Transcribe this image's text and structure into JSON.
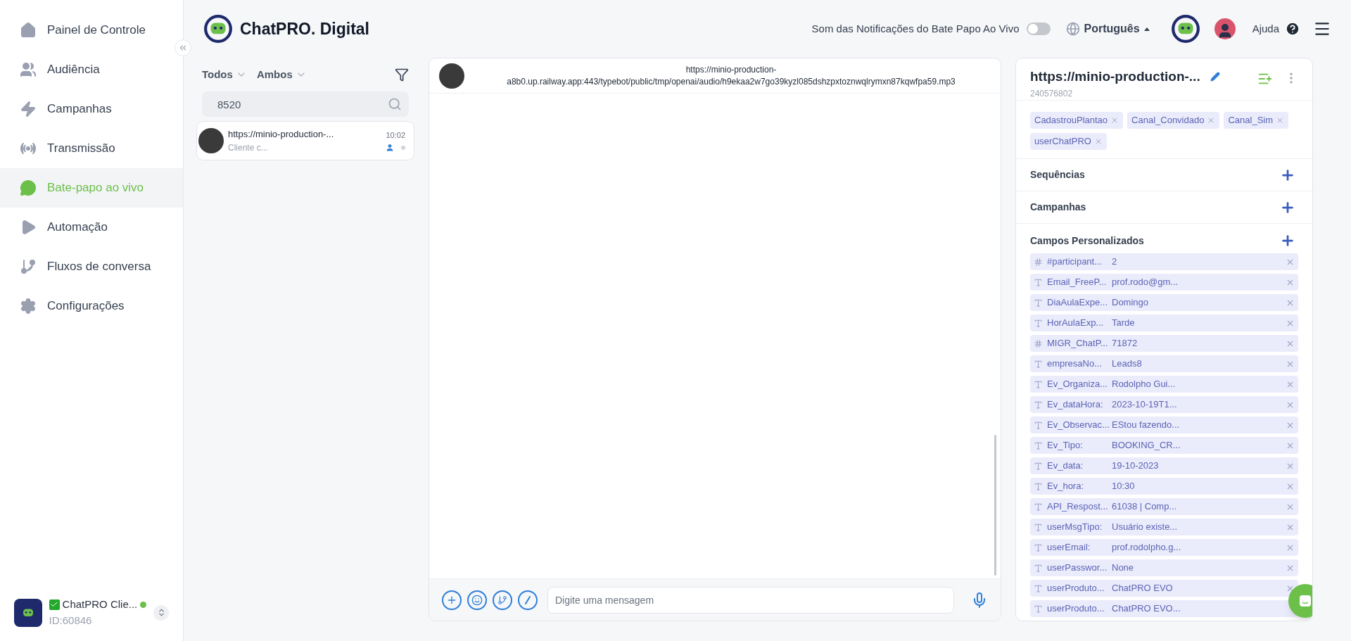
{
  "sidebar": {
    "items": [
      {
        "label": "Painel de Controle",
        "selected": false
      },
      {
        "label": "Audiência",
        "selected": false
      },
      {
        "label": "Campanhas",
        "selected": false
      },
      {
        "label": "Transmissão",
        "selected": false
      },
      {
        "label": "Bate-papo ao vivo",
        "selected": true
      },
      {
        "label": "Automação",
        "selected": false
      },
      {
        "label": "Fluxos de conversa",
        "selected": false
      },
      {
        "label": "Configurações",
        "selected": false
      }
    ],
    "account": {
      "name": "ChatPRO Clie...",
      "id": "ID:60846",
      "online": true
    }
  },
  "header": {
    "brand": "ChatPRO. Digital",
    "notification_label": "Som das Notificações do Bate Papo Ao Vivo",
    "notification_on": false,
    "language": "Português",
    "help": "Ajuda"
  },
  "chat_list": {
    "filters": [
      "Todos",
      "Ambos"
    ],
    "search": {
      "value": "8520"
    },
    "items": [
      {
        "title": "https://minio-production-...",
        "preview": "Cliente c...",
        "time": "10:02",
        "selected": true
      }
    ]
  },
  "conversation": {
    "title": "https://minio-production-a8b0.up.railway.app:443/typebot/public/tmp/openai/audio/h9ekaa2w7go39kyzl085dshzpxtoznwqlrymxn87kqwfpa59.mp3",
    "input": {
      "placeholder": "Digite uma mensagem"
    }
  },
  "contact": {
    "name": "https://minio-production-...",
    "id": "240576802",
    "tags": [
      "CadastrouPlantao",
      "Canal_Convidado",
      "Canal_Sim",
      "userChatPRO"
    ],
    "sections": [
      "Sequências",
      "Campanhas",
      "Campos Personalizados"
    ],
    "fields": [
      {
        "kind": "number",
        "name": "#participant...",
        "value": "2",
        "remove_visible": true
      },
      {
        "kind": "text",
        "name": "Email_FreeP...",
        "value": "prof.rodo@gm...",
        "remove_visible": true
      },
      {
        "kind": "text",
        "name": "DiaAulaExpe...",
        "value": "Domingo",
        "remove_visible": true
      },
      {
        "kind": "text",
        "name": "HorAulaExp...",
        "value": "Tarde",
        "remove_visible": true
      },
      {
        "kind": "number",
        "name": "MIGR_ChatP...",
        "value": "71872",
        "remove_visible": true
      },
      {
        "kind": "text",
        "name": "empresaNo...",
        "value": "Leads8",
        "remove_visible": true
      },
      {
        "kind": "text",
        "name": "Ev_Organiza...",
        "value": "Rodolpho Gui...",
        "remove_visible": true
      },
      {
        "kind": "text",
        "name": "Ev_dataHora:",
        "value": "2023-10-19T1...",
        "remove_visible": true
      },
      {
        "kind": "text",
        "name": "Ev_Observac...",
        "value": "EStou fazendo...",
        "remove_visible": true
      },
      {
        "kind": "text",
        "name": "Ev_Tipo:",
        "value": "BOOKING_CR...",
        "remove_visible": true
      },
      {
        "kind": "text",
        "name": "Ev_data:",
        "value": "19-10-2023",
        "remove_visible": true
      },
      {
        "kind": "text",
        "name": "Ev_hora:",
        "value": "10:30",
        "remove_visible": true
      },
      {
        "kind": "text",
        "name": "API_Respost...",
        "value": "61038 | Comp...",
        "remove_visible": true
      },
      {
        "kind": "text",
        "name": "userMsgTipo:",
        "value": "Usuário existe...",
        "remove_visible": true
      },
      {
        "kind": "text",
        "name": "userEmail:",
        "value": "prof.rodolpho.g...",
        "remove_visible": true
      },
      {
        "kind": "text",
        "name": "userPasswor...",
        "value": "None",
        "remove_visible": true
      },
      {
        "kind": "text",
        "name": "userProduto...",
        "value": "ChatPRO EVO",
        "remove_visible": true
      },
      {
        "kind": "text",
        "name": "userProduto...",
        "value": "ChatPRO EVO...",
        "remove_visible": false
      }
    ]
  }
}
